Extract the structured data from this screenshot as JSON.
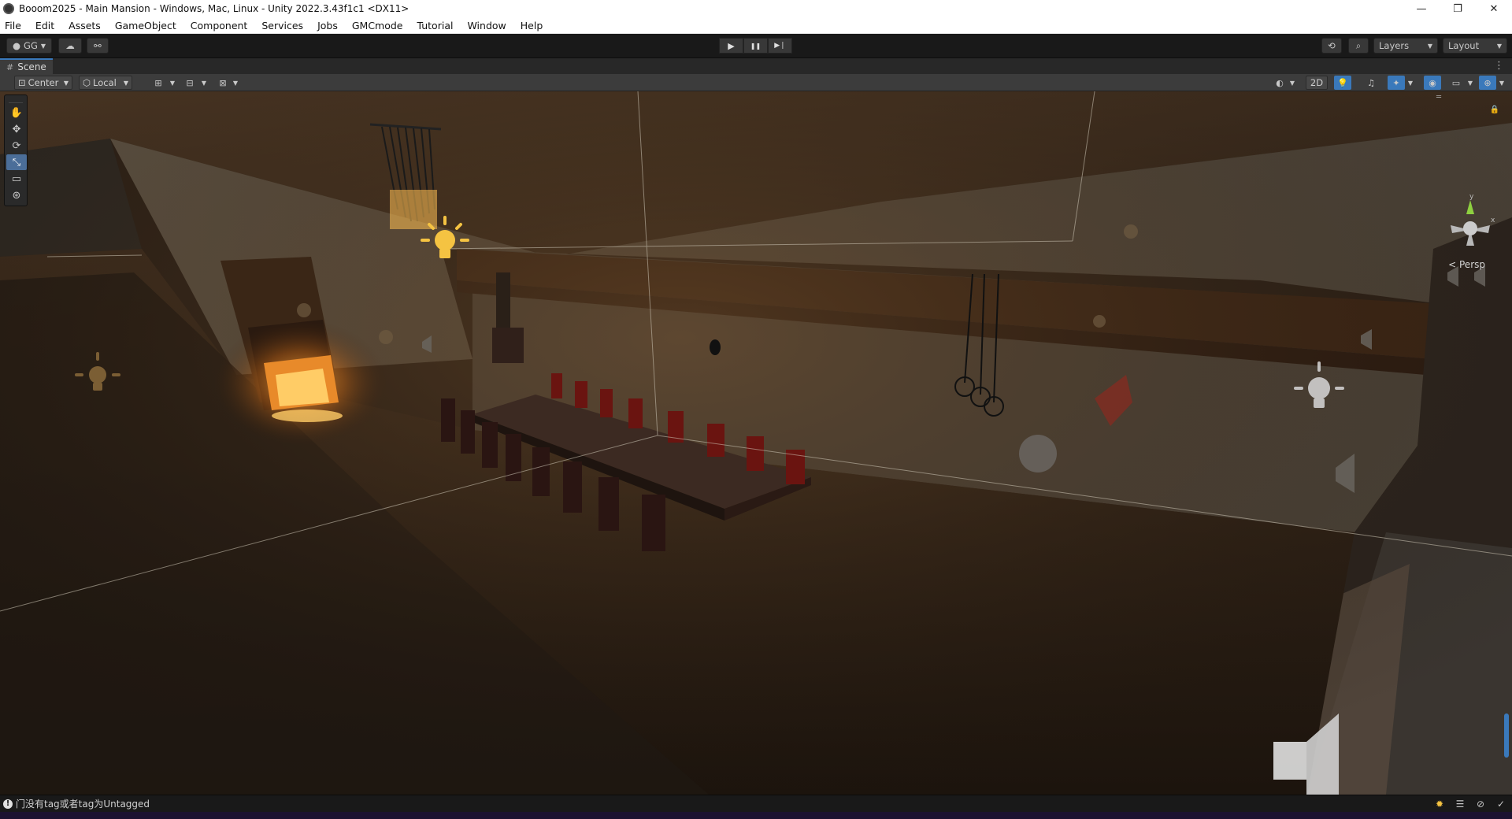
{
  "window": {
    "title": "Booom2025 - Main Mansion - Windows, Mac, Linux - Unity 2022.3.43f1c1 <DX11>",
    "minimize": "—",
    "maximize": "❐",
    "close": "✕"
  },
  "menu": {
    "items": [
      "File",
      "Edit",
      "Assets",
      "GameObject",
      "Component",
      "Services",
      "Jobs",
      "GMCmode",
      "Tutorial",
      "Window",
      "Help"
    ]
  },
  "toolbar": {
    "account_label": "GG",
    "play_icon": "▶",
    "pause_icon": "❚❚",
    "step_icon": "▶❘",
    "layers_label": "Layers",
    "layout_label": "Layout"
  },
  "scene_tab": {
    "label": "Scene"
  },
  "scene_toolbar": {
    "pivot_label": "Center",
    "space_label": "Local",
    "mode_2d_label": "2D"
  },
  "viewport": {
    "projection_label": "Persp",
    "gizmo_axes": {
      "y": "y",
      "x": "x"
    }
  },
  "status": {
    "message": "门没有tag或者tag为Untagged"
  },
  "colors": {
    "accent": "#3a79bb",
    "light_icon": "#f5c342",
    "editor_bg": "#191919"
  }
}
